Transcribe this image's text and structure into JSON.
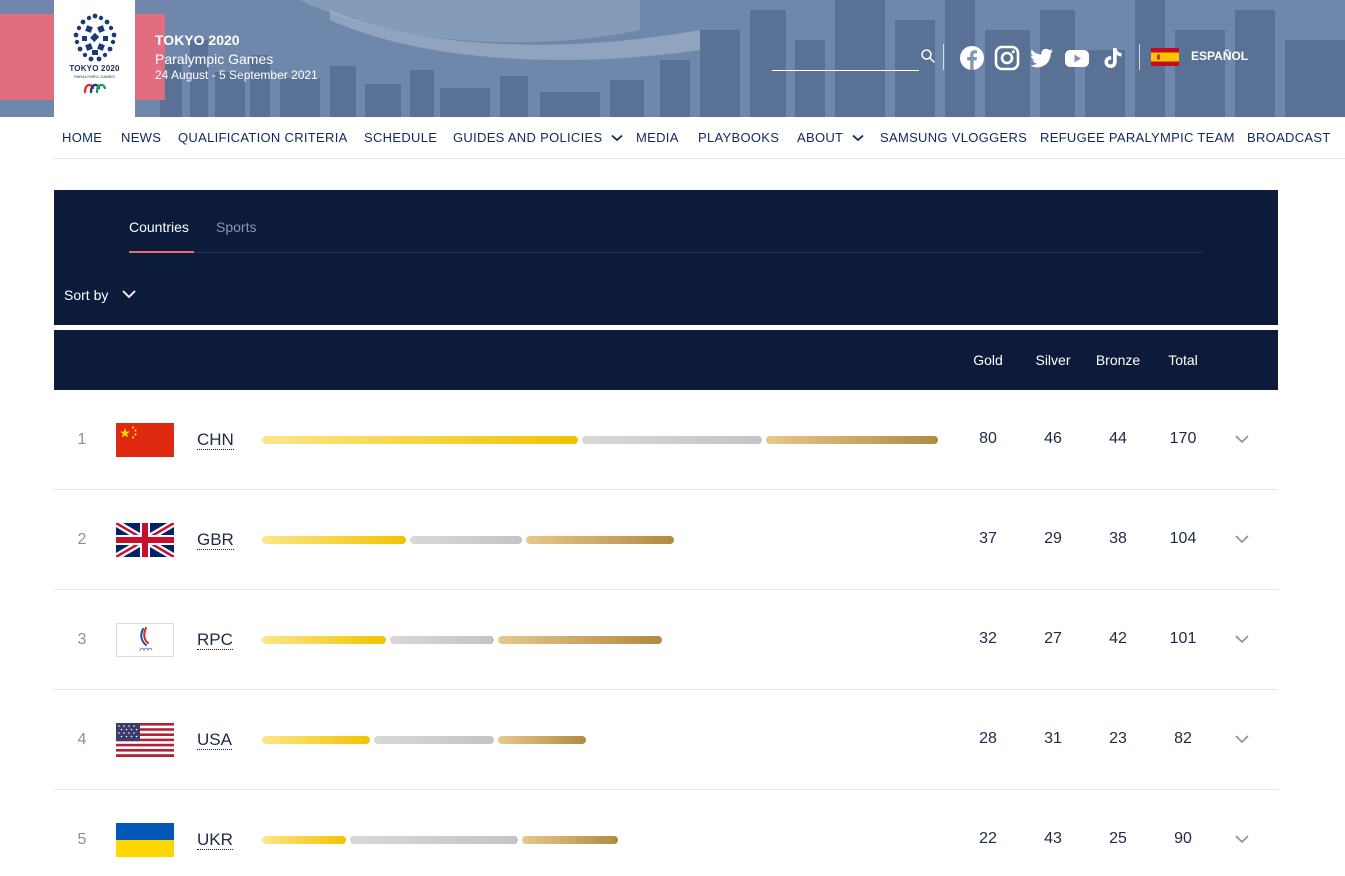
{
  "header": {
    "logo_text": "TOKYO 2020",
    "logo_subtext": "PARALYMPIC GAMES",
    "title": "TOKYO 2020",
    "subtitle": "Paralympic Games",
    "dates": "24 August - 5 September 2021",
    "language_label": "ESPAÑOL",
    "social_icons": [
      "facebook-icon",
      "instagram-icon",
      "twitter-icon",
      "youtube-icon",
      "tiktok-icon"
    ]
  },
  "nav": {
    "items": [
      {
        "label": "HOME",
        "dropdown": false
      },
      {
        "label": "NEWS",
        "dropdown": false
      },
      {
        "label": "QUALIFICATION CRITERIA",
        "dropdown": false
      },
      {
        "label": "SCHEDULE",
        "dropdown": false
      },
      {
        "label": "GUIDES AND POLICIES",
        "dropdown": true
      },
      {
        "label": "MEDIA",
        "dropdown": false
      },
      {
        "label": "PLAYBOOKS",
        "dropdown": false
      },
      {
        "label": "ABOUT",
        "dropdown": true
      },
      {
        "label": "SAMSUNG VLOGGERS",
        "dropdown": false
      },
      {
        "label": "REFUGEE PARALYMPIC TEAM",
        "dropdown": false
      },
      {
        "label": "BROADCAST",
        "dropdown": false
      }
    ]
  },
  "medals": {
    "tabs": [
      {
        "label": "Countries",
        "active": true
      },
      {
        "label": "Sports",
        "active": false
      }
    ],
    "sort_label": "Sort by",
    "columns": {
      "gold": "Gold",
      "silver": "Silver",
      "bronze": "Bronze",
      "total": "Total"
    },
    "rows": [
      {
        "rank": "1",
        "code": "CHN",
        "gold": 80,
        "silver": 46,
        "bronze": 44,
        "total": 170
      },
      {
        "rank": "2",
        "code": "GBR",
        "gold": 37,
        "silver": 29,
        "bronze": 38,
        "total": 104
      },
      {
        "rank": "3",
        "code": "RPC",
        "gold": 32,
        "silver": 27,
        "bronze": 42,
        "total": 101
      },
      {
        "rank": "4",
        "code": "USA",
        "gold": 28,
        "silver": 31,
        "bronze": 23,
        "total": 82
      },
      {
        "rank": "5",
        "code": "UKR",
        "gold": 22,
        "silver": 43,
        "bronze": 25,
        "total": 90
      }
    ]
  },
  "colors": {
    "navy": "#0c1b3a",
    "accent_pink": "#ea6a7c",
    "gold": "#f2c200",
    "silver": "#c4c4c4",
    "bronze": "#b18a42"
  }
}
